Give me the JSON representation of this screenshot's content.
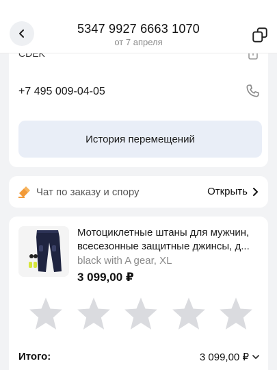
{
  "header": {
    "title": "5347 9927 6663 1070",
    "subtitle": "от 7 апреля"
  },
  "delivery": {
    "service": "CDEK",
    "phone": "+7 495 009-04-05",
    "history_button": "История перемещений"
  },
  "chat": {
    "label": "Чат по заказу и спору",
    "open_link": "Открыть"
  },
  "product": {
    "title_line1": "Мотоциклетные штаны для мужчин,",
    "title_line2": "всесезонные защитные джинсы, д...",
    "variant": "black with A gear, XL",
    "price": "3 099,00 ₽",
    "rating_max": 5,
    "rating_value": 0
  },
  "total": {
    "label": "Итого:",
    "value": "3 099,00 ₽"
  },
  "colors": {
    "accent_button_bg": "#e9eef7",
    "star_empty": "#dadbdf",
    "chat_icon": "#f29a38"
  },
  "icons": [
    "back-chevron-icon",
    "copy-icon",
    "share-icon",
    "phone-icon",
    "chat-icon",
    "chevron-right-icon",
    "star-icon",
    "chevron-down-icon"
  ]
}
